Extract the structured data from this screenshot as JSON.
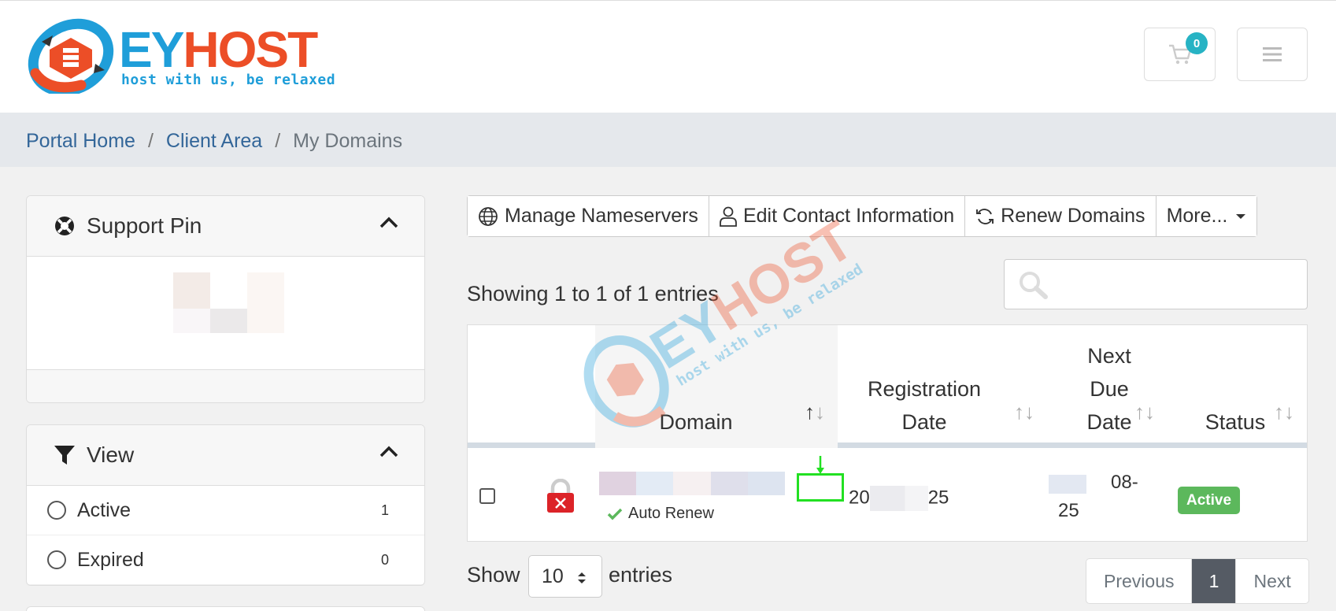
{
  "header": {
    "logo": {
      "brand_ey": "EY",
      "brand_host": "HOST",
      "tagline": "host with us, be relaxed"
    },
    "cart": {
      "count": "0",
      "icon": "cart-icon"
    },
    "menu": {
      "icon": "hamburger-icon"
    }
  },
  "breadcrumb": {
    "items": [
      "Portal Home",
      "Client Area",
      "My Domains"
    ],
    "separator": "/"
  },
  "sidebar": {
    "support_pin": {
      "title": "Support Pin",
      "icon": "lifebuoy-icon"
    },
    "view": {
      "title": "View",
      "icon": "filter-icon",
      "options": [
        {
          "label": "Active",
          "count": "1"
        },
        {
          "label": "Expired",
          "count": "0"
        }
      ]
    }
  },
  "toolbar": {
    "manage_nameservers": "Manage Nameservers",
    "edit_contact": "Edit Contact Information",
    "renew_domains": "Renew Domains",
    "more": "More..."
  },
  "table": {
    "showing": "Showing 1 to 1 of 1 entries",
    "headers": {
      "domain": "Domain",
      "reg_line1": "Registration",
      "reg_line2": "Date",
      "due_line1": "Next",
      "due_line2": "Due",
      "due_line3": "Date",
      "status": "Status"
    },
    "rows": [
      {
        "auto_renew": "Auto Renew",
        "reg_date_start": "20",
        "reg_date_end": "25",
        "due_date_line1": "08-",
        "due_date_line2": "25",
        "status": "Active"
      }
    ]
  },
  "footer": {
    "show": "Show",
    "page_size": "10",
    "entries": "entries",
    "pagination": {
      "previous": "Previous",
      "current": "1",
      "next": "Next"
    }
  },
  "colors": {
    "brand_blue": "#1f9ed9",
    "brand_orange": "#ec4e27",
    "link": "#336699",
    "status_active": "#5cb85c",
    "cart_badge": "#27b3c4"
  }
}
